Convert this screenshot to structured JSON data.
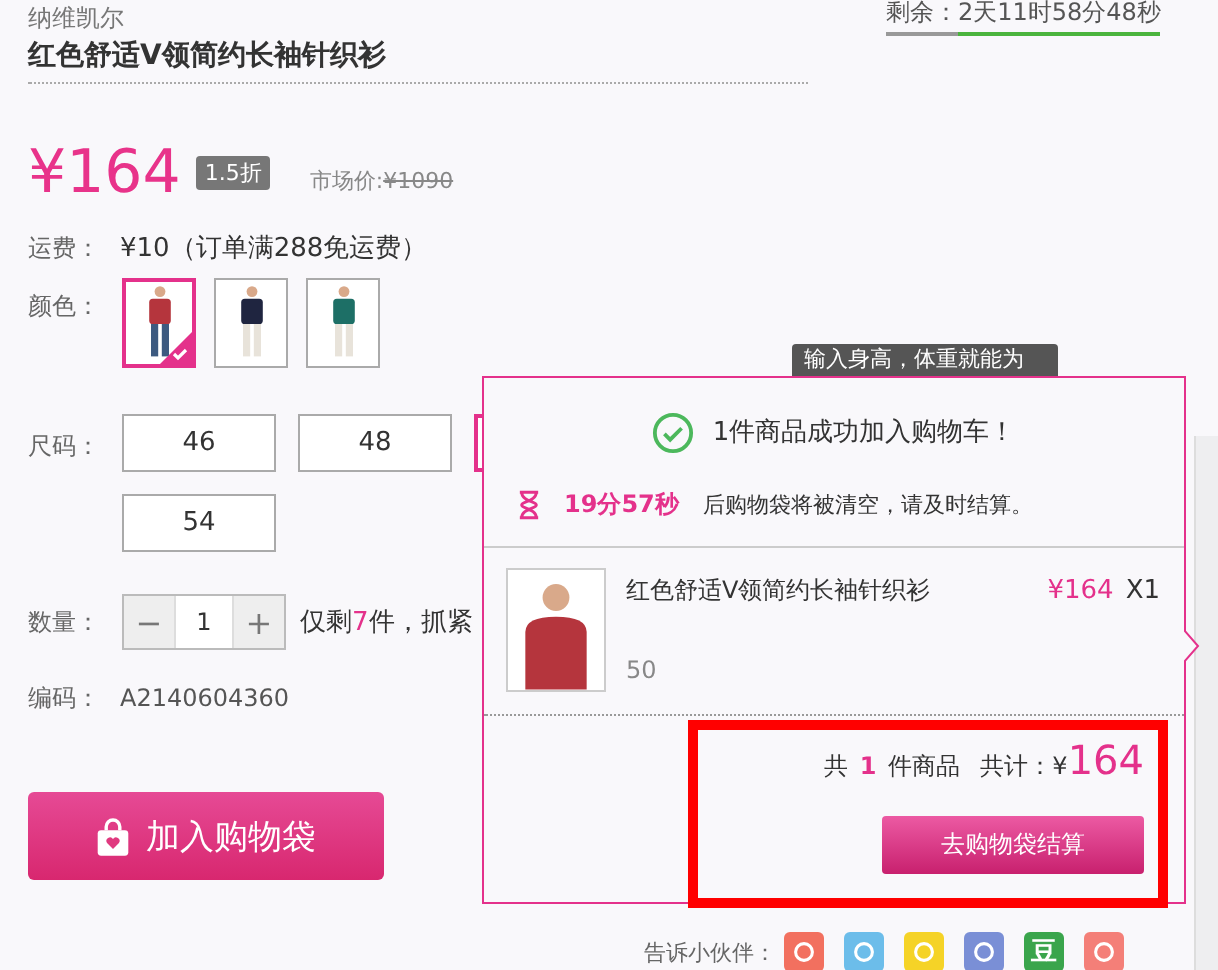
{
  "brand": "纳维凯尔",
  "title": "红色舒适V领简约长袖针织衫",
  "countdown": {
    "label": "剩余：",
    "value": "2天11时58分48秒"
  },
  "price": {
    "current": "¥164",
    "discount": "1.5折",
    "market_label": "市场价:",
    "market_price": "¥1090"
  },
  "shipping": {
    "label": "运费：",
    "value": "¥10（订单满288免运费）"
  },
  "colors": {
    "label": "颜色：",
    "options": [
      {
        "selected": true,
        "color": "#b5353d"
      },
      {
        "selected": false,
        "color": "#1f2540"
      },
      {
        "selected": false,
        "color": "#1d6f66"
      }
    ]
  },
  "sizes": {
    "label": "尺码：",
    "options": [
      {
        "label": "46",
        "selected": false
      },
      {
        "label": "48",
        "selected": false
      },
      {
        "selected": true
      },
      {
        "label": "54",
        "selected": false
      }
    ]
  },
  "size_tooltip": "输入身高，体重就能为",
  "quantity": {
    "label": "数量：",
    "minus": "−",
    "value": "1",
    "plus": "+",
    "stock_prefix": "仅剩",
    "stock_count": "7",
    "stock_suffix": "件，抓紧"
  },
  "code": {
    "label": "编码：",
    "value": "A2140604360"
  },
  "add_button": "加入购物袋",
  "share": {
    "label": "告诉小伙伴：",
    "services": [
      {
        "kind": "icon",
        "color": "#f2705f"
      },
      {
        "kind": "icon",
        "color": "#6cbdea"
      },
      {
        "kind": "icon",
        "color": "#f5d327"
      },
      {
        "kind": "icon",
        "color": "#7a8fd6"
      },
      {
        "kind": "text",
        "color": "#3aa54c",
        "text": "豆"
      },
      {
        "kind": "icon",
        "color": "#f47f78"
      }
    ]
  },
  "cart_popup": {
    "message": "1件商品成功加入购物车！",
    "timer": "19分57秒",
    "timer_note": "后购物袋将被清空，请及时结算。",
    "item": {
      "name": "红色舒适V领简约长袖针织衫",
      "price": "¥164",
      "qty": "X1",
      "size": "50"
    },
    "summary": {
      "prefix": "共",
      "count": "1",
      "suffix": "件商品",
      "total_label": "共计：¥",
      "total": "164"
    },
    "checkout_button": "去购物袋结算"
  }
}
